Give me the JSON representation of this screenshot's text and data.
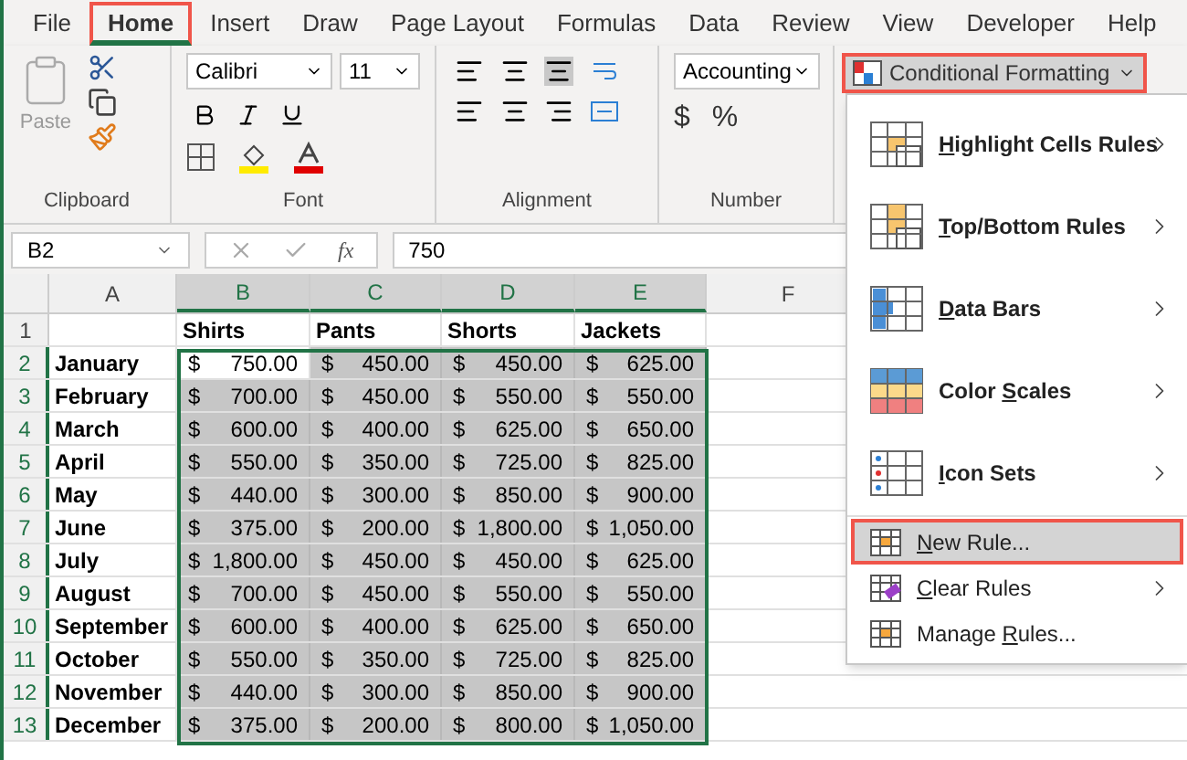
{
  "tabs": [
    {
      "label": "File",
      "selected": false
    },
    {
      "label": "Home",
      "selected": true
    },
    {
      "label": "Insert",
      "selected": false
    },
    {
      "label": "Draw",
      "selected": false
    },
    {
      "label": "Page Layout",
      "selected": false
    },
    {
      "label": "Formulas",
      "selected": false
    },
    {
      "label": "Data",
      "selected": false
    },
    {
      "label": "Review",
      "selected": false
    },
    {
      "label": "View",
      "selected": false
    },
    {
      "label": "Developer",
      "selected": false
    },
    {
      "label": "Help",
      "selected": false
    }
  ],
  "ribbon": {
    "clipboard": {
      "label": "Clipboard",
      "paste": "Paste"
    },
    "font": {
      "label": "Font",
      "font_name": "Calibri",
      "font_size": "11"
    },
    "alignment": {
      "label": "Alignment"
    },
    "number": {
      "label": "Number",
      "format": "Accounting",
      "currency": "$",
      "percent": "%"
    },
    "conditional_formatting": {
      "label": "Conditional Formatting",
      "open": true
    }
  },
  "formula_bar": {
    "name_box": "B2",
    "function_label": "fx",
    "value": "750"
  },
  "sheet": {
    "columns": [
      {
        "label": "A",
        "selected": false
      },
      {
        "label": "B",
        "selected": true
      },
      {
        "label": "C",
        "selected": true
      },
      {
        "label": "D",
        "selected": true
      },
      {
        "label": "E",
        "selected": true
      },
      {
        "label": "F",
        "selected": false
      }
    ],
    "header_row": {
      "number": "1",
      "selected": false,
      "cells": [
        "",
        "Shirts",
        "Pants",
        "Shorts",
        "Jackets"
      ]
    },
    "rows": [
      {
        "number": "2",
        "selected": true,
        "cells": [
          {
            "text": "January"
          },
          {
            "symbol": "$",
            "amount": "750.00",
            "active": true
          },
          {
            "symbol": "$",
            "amount": "450.00",
            "active": false
          },
          {
            "symbol": "$",
            "amount": "450.00",
            "active": false
          },
          {
            "symbol": "$",
            "amount": "625.00",
            "active": false
          }
        ]
      },
      {
        "number": "3",
        "selected": true,
        "cells": [
          {
            "text": "February"
          },
          {
            "symbol": "$",
            "amount": "700.00",
            "active": false
          },
          {
            "symbol": "$",
            "amount": "450.00",
            "active": false
          },
          {
            "symbol": "$",
            "amount": "550.00",
            "active": false
          },
          {
            "symbol": "$",
            "amount": "550.00",
            "active": false
          }
        ]
      },
      {
        "number": "4",
        "selected": true,
        "cells": [
          {
            "text": "March"
          },
          {
            "symbol": "$",
            "amount": "600.00",
            "active": false
          },
          {
            "symbol": "$",
            "amount": "400.00",
            "active": false
          },
          {
            "symbol": "$",
            "amount": "625.00",
            "active": false
          },
          {
            "symbol": "$",
            "amount": "650.00",
            "active": false
          }
        ]
      },
      {
        "number": "5",
        "selected": true,
        "cells": [
          {
            "text": "April"
          },
          {
            "symbol": "$",
            "amount": "550.00",
            "active": false
          },
          {
            "symbol": "$",
            "amount": "350.00",
            "active": false
          },
          {
            "symbol": "$",
            "amount": "725.00",
            "active": false
          },
          {
            "symbol": "$",
            "amount": "825.00",
            "active": false
          }
        ]
      },
      {
        "number": "6",
        "selected": true,
        "cells": [
          {
            "text": "May"
          },
          {
            "symbol": "$",
            "amount": "440.00",
            "active": false
          },
          {
            "symbol": "$",
            "amount": "300.00",
            "active": false
          },
          {
            "symbol": "$",
            "amount": "850.00",
            "active": false
          },
          {
            "symbol": "$",
            "amount": "900.00",
            "active": false
          }
        ]
      },
      {
        "number": "7",
        "selected": true,
        "cells": [
          {
            "text": "June"
          },
          {
            "symbol": "$",
            "amount": "375.00",
            "active": false
          },
          {
            "symbol": "$",
            "amount": "200.00",
            "active": false
          },
          {
            "symbol": "$",
            "amount": "1,800.00",
            "active": false
          },
          {
            "symbol": "$",
            "amount": "1,050.00",
            "active": false
          }
        ]
      },
      {
        "number": "8",
        "selected": true,
        "cells": [
          {
            "text": "July"
          },
          {
            "symbol": "$",
            "amount": "1,800.00",
            "active": false
          },
          {
            "symbol": "$",
            "amount": "450.00",
            "active": false
          },
          {
            "symbol": "$",
            "amount": "450.00",
            "active": false
          },
          {
            "symbol": "$",
            "amount": "625.00",
            "active": false
          }
        ]
      },
      {
        "number": "9",
        "selected": true,
        "cells": [
          {
            "text": "August"
          },
          {
            "symbol": "$",
            "amount": "700.00",
            "active": false
          },
          {
            "symbol": "$",
            "amount": "450.00",
            "active": false
          },
          {
            "symbol": "$",
            "amount": "550.00",
            "active": false
          },
          {
            "symbol": "$",
            "amount": "550.00",
            "active": false
          }
        ]
      },
      {
        "number": "10",
        "selected": true,
        "cells": [
          {
            "text": "September"
          },
          {
            "symbol": "$",
            "amount": "600.00",
            "active": false
          },
          {
            "symbol": "$",
            "amount": "400.00",
            "active": false
          },
          {
            "symbol": "$",
            "amount": "625.00",
            "active": false
          },
          {
            "symbol": "$",
            "amount": "650.00",
            "active": false
          }
        ]
      },
      {
        "number": "11",
        "selected": true,
        "cells": [
          {
            "text": "October"
          },
          {
            "symbol": "$",
            "amount": "550.00",
            "active": false
          },
          {
            "symbol": "$",
            "amount": "350.00",
            "active": false
          },
          {
            "symbol": "$",
            "amount": "725.00",
            "active": false
          },
          {
            "symbol": "$",
            "amount": "825.00",
            "active": false
          }
        ]
      },
      {
        "number": "12",
        "selected": true,
        "cells": [
          {
            "text": "November"
          },
          {
            "symbol": "$",
            "amount": "440.00",
            "active": false
          },
          {
            "symbol": "$",
            "amount": "300.00",
            "active": false
          },
          {
            "symbol": "$",
            "amount": "850.00",
            "active": false
          },
          {
            "symbol": "$",
            "amount": "900.00",
            "active": false
          }
        ]
      },
      {
        "number": "13",
        "selected": true,
        "cells": [
          {
            "text": "December"
          },
          {
            "symbol": "$",
            "amount": "375.00",
            "active": false
          },
          {
            "symbol": "$",
            "amount": "200.00",
            "active": false
          },
          {
            "symbol": "$",
            "amount": "800.00",
            "active": false
          },
          {
            "symbol": "$",
            "amount": "1,050.00",
            "active": false
          }
        ]
      }
    ]
  },
  "menu": {
    "items": [
      {
        "kind": "large",
        "key": "H",
        "after": "ighlight Cells Rules",
        "submenu": true,
        "highlighted": false
      },
      {
        "kind": "large",
        "key": "T",
        "after": "op/Bottom Rules",
        "submenu": true,
        "highlighted": false
      },
      {
        "kind": "large",
        "key": "D",
        "after": "ata Bars",
        "submenu": true,
        "highlighted": false
      },
      {
        "kind": "large",
        "before": "Color ",
        "key": "S",
        "after": "cales",
        "submenu": true,
        "highlighted": false
      },
      {
        "kind": "large",
        "key": "I",
        "after": "con Sets",
        "submenu": true,
        "highlighted": false
      },
      {
        "kind": "small",
        "key": "N",
        "after": "ew Rule...",
        "submenu": false,
        "highlighted": true
      },
      {
        "kind": "small",
        "key": "C",
        "after": "lear Rules",
        "submenu": true,
        "highlighted": false
      },
      {
        "kind": "small",
        "before": "Manage ",
        "key": "R",
        "after": "ules...",
        "submenu": false,
        "highlighted": false
      }
    ]
  }
}
